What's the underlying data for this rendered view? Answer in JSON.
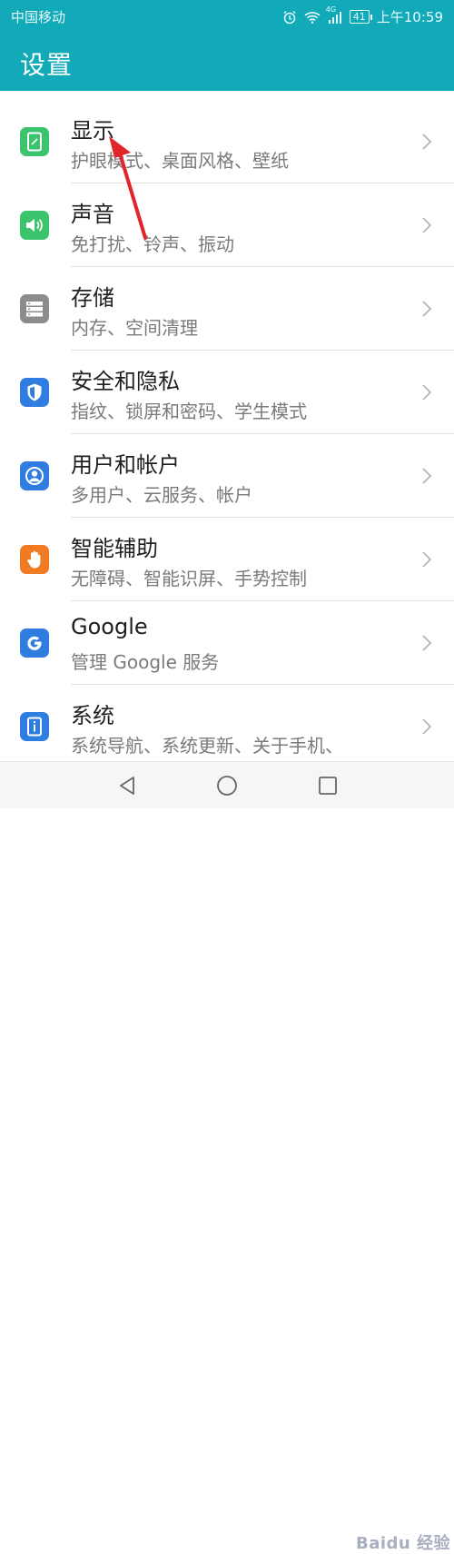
{
  "status_bar": {
    "carrier": "中国移动",
    "network_badge": "4G",
    "battery": "41",
    "time": "上午10:59"
  },
  "header": {
    "title": "设置"
  },
  "settings": [
    {
      "title": "显示",
      "subtitle": "护眼模式、桌面风格、壁纸",
      "icon": "display-icon",
      "color": "#3cc36d"
    },
    {
      "title": "声音",
      "subtitle": "免打扰、铃声、振动",
      "icon": "speaker-icon",
      "color": "#3cc36d"
    },
    {
      "title": "存储",
      "subtitle": "内存、空间清理",
      "icon": "storage-icon",
      "color": "#8c8c8c"
    },
    {
      "title": "安全和隐私",
      "subtitle": "指纹、锁屏和密码、学生模式",
      "icon": "shield-icon",
      "color": "#2f7de1"
    },
    {
      "title": "用户和帐户",
      "subtitle": "多用户、云服务、帐户",
      "icon": "user-icon",
      "color": "#2f7de1"
    },
    {
      "title": "智能辅助",
      "subtitle": "无障碍、智能识屏、手势控制",
      "icon": "hand-icon",
      "color": "#f07b22"
    },
    {
      "title": "Google",
      "subtitle": "管理 Google 服务",
      "icon": "google-icon",
      "color": "#2f7de1"
    },
    {
      "title": "系统",
      "subtitle": "系统导航、系统更新、关于手机、",
      "icon": "info-icon",
      "color": "#2f7de1"
    }
  ],
  "navigation": {
    "back": "back-icon",
    "home": "home-icon",
    "recents": "recents-icon"
  },
  "watermark": "Baidu 经验",
  "colors": {
    "accent": "#12aab9",
    "annotation_arrow": "#e0262b"
  }
}
